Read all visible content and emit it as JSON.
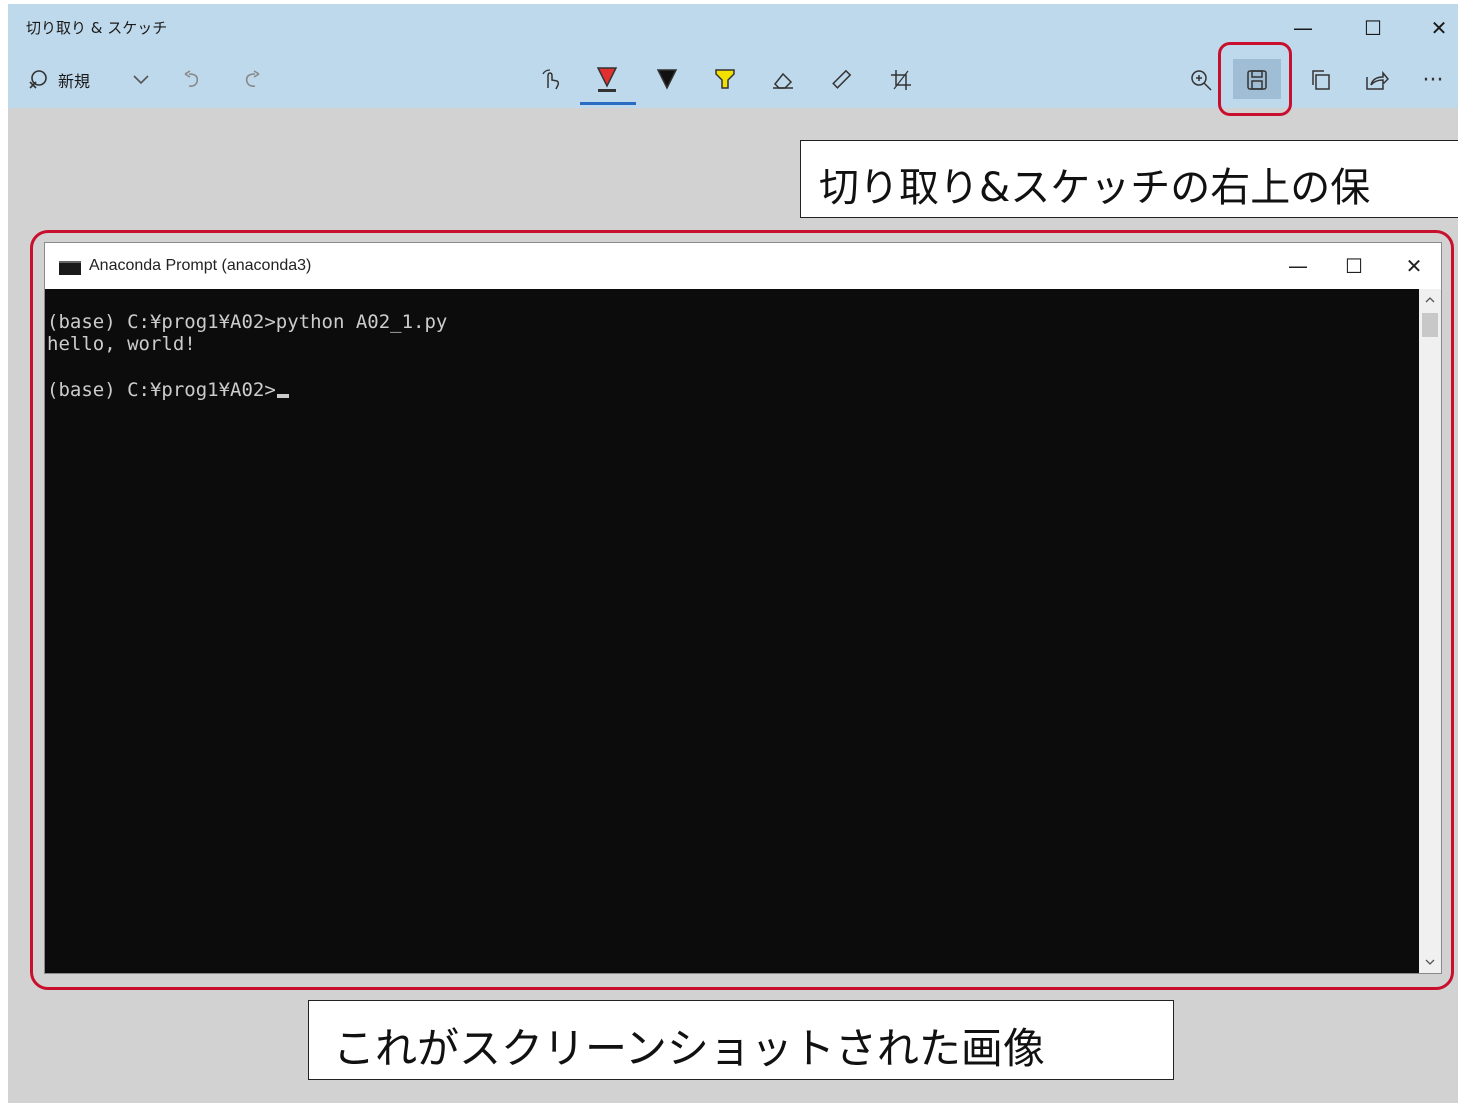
{
  "snip_app": {
    "title": "切り取り & スケッチ",
    "new_label": "新規",
    "window_controls": {
      "minimize": "—",
      "maximize": "☐",
      "close": "✕"
    },
    "more_label": "···"
  },
  "annotations": {
    "top_note": "切り取り&スケッチの右上の保",
    "bottom_note": "これがスクリーンショットされた画像"
  },
  "console_window": {
    "title": "Anaconda Prompt (anaconda3)",
    "controls": {
      "minimize": "—",
      "maximize": "☐",
      "close": "✕"
    },
    "lines": [
      "(base) C:¥prog1¥A02>python A02_1.py",
      "hello, world!",
      "",
      "(base) C:¥prog1¥A02>"
    ]
  },
  "colors": {
    "chrome_bg": "#bfd9ec",
    "highlight_red": "#c8102e",
    "pen_red": "#e03030",
    "pen_black": "#111111",
    "highlighter_yellow": "#f2e000",
    "console_bg": "#0c0c0c",
    "console_fg": "#cccccc"
  },
  "icons": {
    "new": "snip-new-icon",
    "dropdown": "chevron-down-icon",
    "undo": "undo-icon",
    "redo": "redo-icon",
    "touch": "touch-writing-icon",
    "ballpoint": "ballpoint-pen-icon",
    "pencil": "pencil-icon",
    "highlighter": "highlighter-icon",
    "eraser": "eraser-icon",
    "ruler": "ruler-icon",
    "crop": "crop-icon",
    "zoom": "zoom-in-icon",
    "save": "save-icon",
    "copy": "copy-icon",
    "share": "share-icon"
  }
}
